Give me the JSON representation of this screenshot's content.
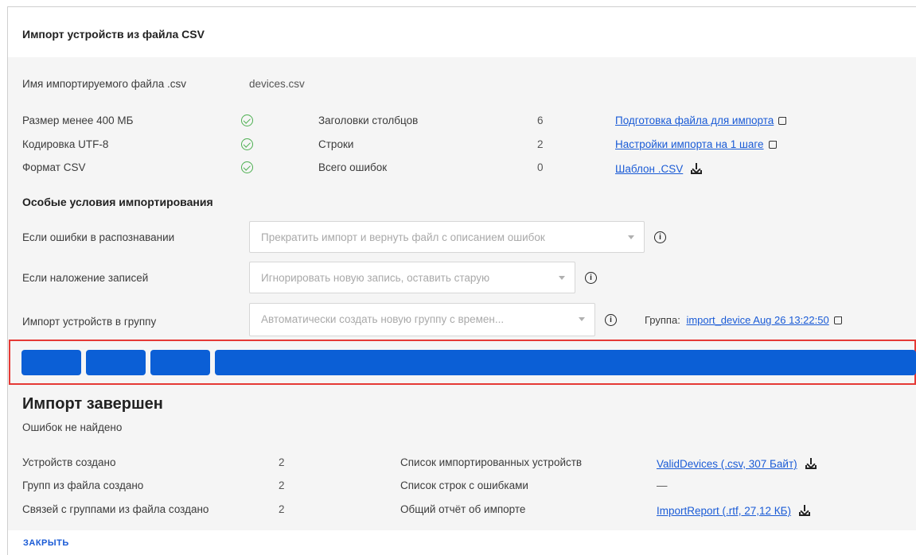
{
  "dialog": {
    "title": "Импорт устройств из файла CSV",
    "close_label": "ЗАКРЫТЬ"
  },
  "file": {
    "name_label": "Имя импортируемого файла .csv",
    "name_value": "devices.csv"
  },
  "checks": [
    {
      "label": "Размер менее 400 МБ",
      "status": "ok",
      "icon": "check-circle-icon"
    },
    {
      "label": "Кодировка UTF-8",
      "status": "ok",
      "icon": "check-circle-icon"
    },
    {
      "label": "Формат CSV",
      "status": "ok",
      "icon": "check-circle-icon"
    }
  ],
  "stats": [
    {
      "label": "Заголовки столбцов",
      "value": "6"
    },
    {
      "label": "Строки",
      "value": "2"
    },
    {
      "label": "Всего ошибок",
      "value": "0"
    }
  ],
  "links": [
    {
      "text": "Подготовка файла для импорта",
      "icon": "external-link-icon"
    },
    {
      "text": "Настройки импорта на 1 шаге",
      "icon": "external-link-icon"
    },
    {
      "text": "Шаблон .CSV",
      "icon": "download-icon"
    }
  ],
  "special": {
    "title": "Особые условия импортирования",
    "rows": [
      {
        "label": "Если ошибки в распознавании",
        "value": "Прекратить импорт и вернуть файл с описанием ошибок"
      },
      {
        "label": "Если наложение записей",
        "value": "Игнорировать новую запись, оставить старую"
      },
      {
        "label": "Импорт устройств в группу",
        "value": "Автоматически создать новую группу с времен..."
      }
    ],
    "group_label": "Группа:",
    "group_link": "import_device Aug 26 13:22:50"
  },
  "progress": {
    "segments": 4,
    "color": "#0b5fd6",
    "highlight_color": "#e53935"
  },
  "result": {
    "title": "Импорт завершен",
    "subtitle": "Ошибок не найдено",
    "stats": [
      {
        "label": "Устройств создано",
        "value": "2"
      },
      {
        "label": "Групп из файла создано",
        "value": "2"
      },
      {
        "label": "Связей с группами из файла создано",
        "value": "2"
      }
    ],
    "files": [
      {
        "label": "Список импортированных устройств",
        "value": "ValidDevices (.csv, 307 Байт)",
        "icon": "download-icon"
      },
      {
        "label": "Список строк с ошибками",
        "value": "—"
      },
      {
        "label": "Общий отчёт об импорте",
        "value": "ImportReport (.rtf, 27,12 КБ)",
        "icon": "download-icon"
      }
    ]
  }
}
